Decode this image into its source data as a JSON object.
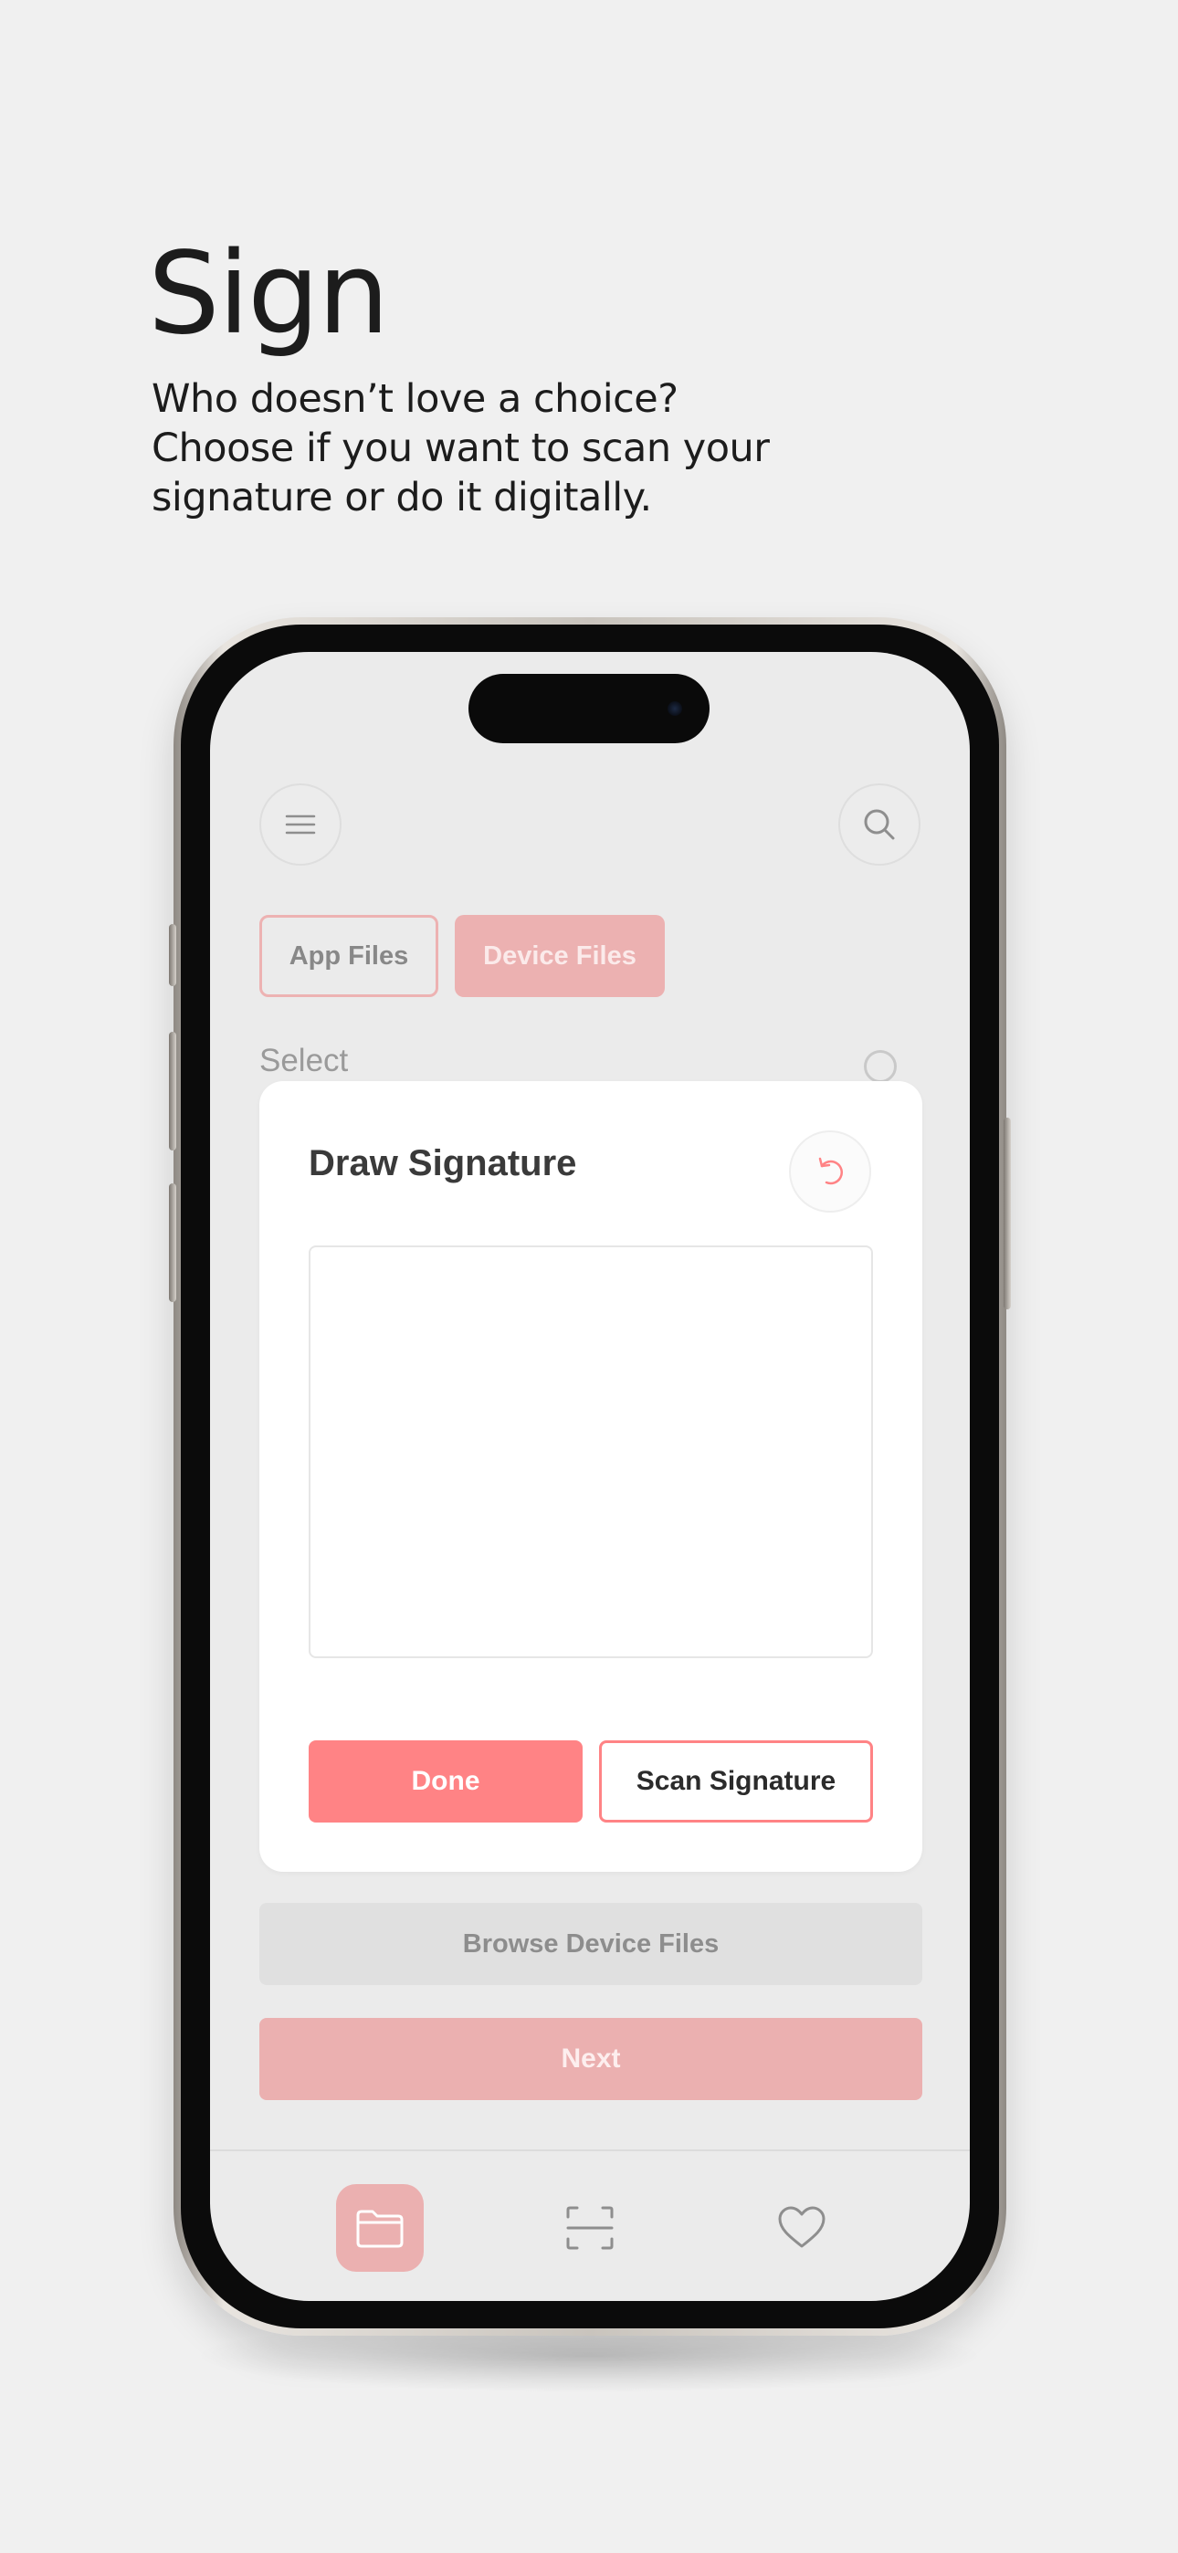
{
  "header": {
    "title": "Sign",
    "subtitle_lines": [
      "Who doesn’t love a choice?",
      "Choose if you want to scan your",
      "signature or do it digitally."
    ]
  },
  "app": {
    "topbar": {
      "menu_icon": "hamburger-icon",
      "search_icon": "search-icon"
    },
    "tabs": [
      {
        "label": "App Files",
        "active": false
      },
      {
        "label": "Device Files",
        "active": true
      }
    ],
    "select_label": "Select",
    "modal": {
      "title": "Draw Signature",
      "undo_icon": "undo-icon",
      "done_label": "Done",
      "scan_label": "Scan Signature"
    },
    "browse_label": "Browse Device Files",
    "next_label": "Next",
    "bottom_nav": [
      {
        "icon": "folder-icon",
        "active": true
      },
      {
        "icon": "scan-frame-icon",
        "active": false
      },
      {
        "icon": "heart-icon",
        "active": false
      }
    ]
  },
  "colors": {
    "accent": "#ff8385",
    "accent_muted": "#ebb0b0",
    "background": "#f0f0f0",
    "screen": "#ebebeb"
  }
}
